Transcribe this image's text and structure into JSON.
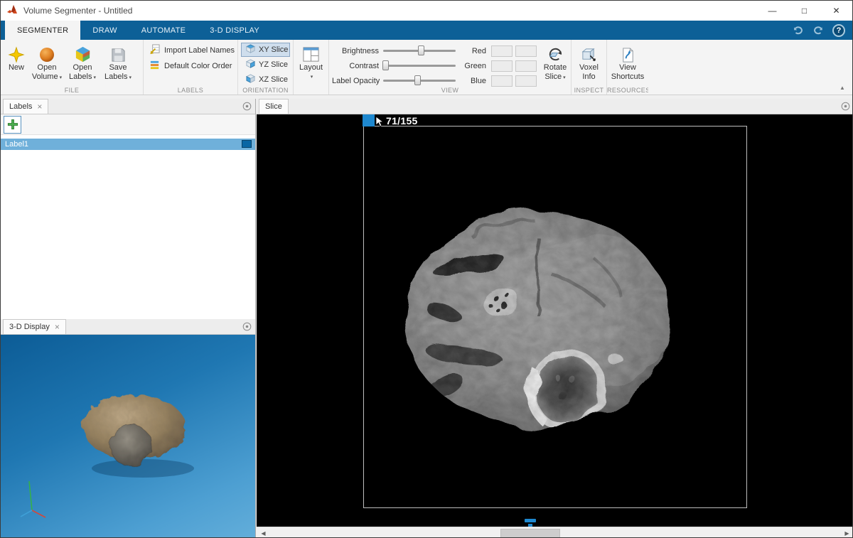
{
  "colors": {
    "accent_blue": "#1e88cf",
    "ribbon_blue": "#0d6097",
    "selection_blue": "#6fb0da",
    "label1_chip": "#0a66a4"
  },
  "window": {
    "title": "Volume Segmenter - Untitled"
  },
  "tabstrip": {
    "tabs": [
      {
        "label": "SEGMENTER"
      },
      {
        "label": "DRAW"
      },
      {
        "label": "AUTOMATE"
      },
      {
        "label": "3-D DISPLAY"
      }
    ]
  },
  "ribbon": {
    "file": {
      "section_label": "FILE",
      "new_label": "New",
      "open_volume": {
        "line1": "Open",
        "line2": "Volume"
      },
      "open_labels": {
        "line1": "Open",
        "line2": "Labels"
      },
      "save_labels": {
        "line1": "Save",
        "line2": "Labels"
      }
    },
    "labels": {
      "section_label": "LABELS",
      "import_label_names": "Import Label Names",
      "default_color_order": "Default Color Order"
    },
    "orientation": {
      "section_label": "ORIENTATION",
      "selected": "XY Slice",
      "options": [
        {
          "label": "XY Slice"
        },
        {
          "label": "YZ Slice"
        },
        {
          "label": "XZ Slice"
        }
      ]
    },
    "layout": {
      "label": "Layout"
    },
    "view": {
      "section_label": "VIEW",
      "sliders": [
        {
          "label": "Brightness",
          "value_pct": 52
        },
        {
          "label": "Contrast",
          "value_pct": 3
        },
        {
          "label": "Label Opacity",
          "value_pct": 47
        }
      ],
      "channels": [
        {
          "label": "Red"
        },
        {
          "label": "Green"
        },
        {
          "label": "Blue"
        }
      ],
      "rotate_slice": {
        "line1": "Rotate",
        "line2": "Slice"
      }
    },
    "inspect": {
      "section_label": "INSPECT",
      "voxel_info": {
        "line1": "Voxel",
        "line2": "Info"
      }
    },
    "resources": {
      "section_label": "RESOURCES",
      "view_shortcuts": {
        "line1": "View",
        "line2": "Shortcuts"
      }
    }
  },
  "labels_panel": {
    "tab_label": "Labels",
    "items": [
      {
        "name": "Label1",
        "color": "#0a66a4"
      }
    ]
  },
  "display3d_panel": {
    "tab_label": "3-D Display"
  },
  "slice_panel": {
    "tab_label": "Slice",
    "slice_indicator": "71/155"
  }
}
